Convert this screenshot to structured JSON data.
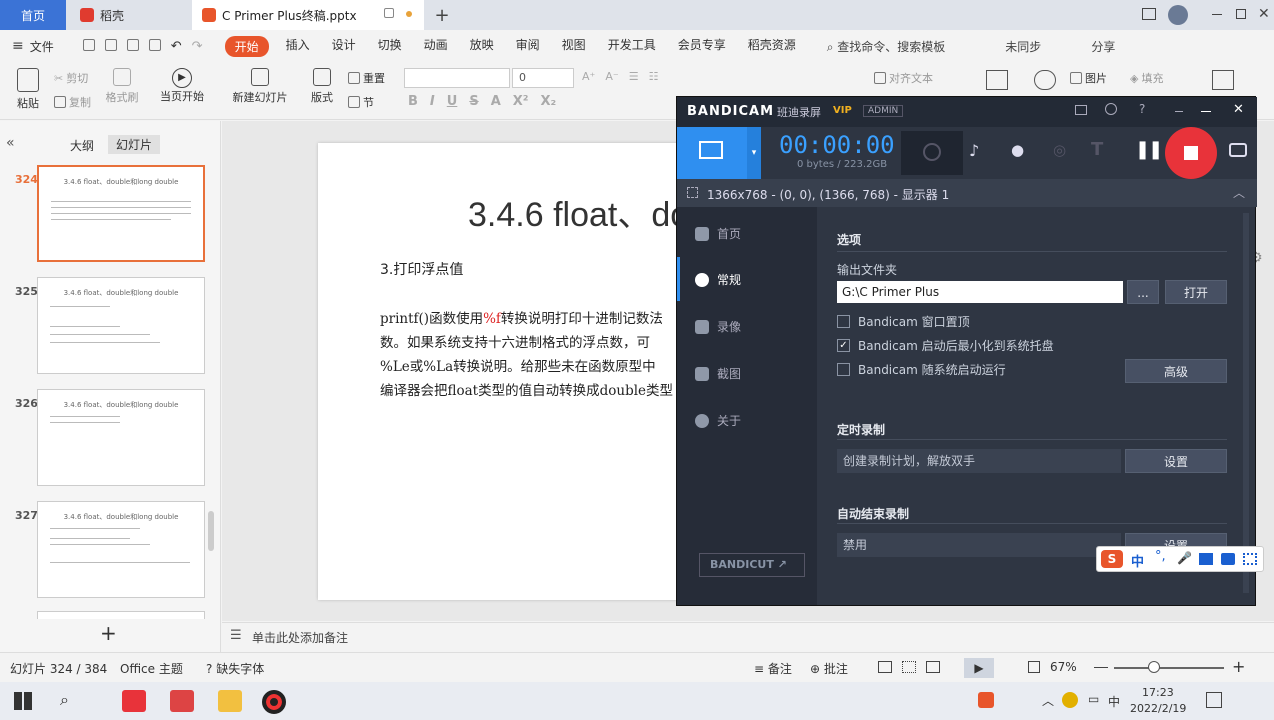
{
  "tabs": {
    "home": "首页",
    "daoke": "稻壳",
    "document": "C Primer  Plus终稿.pptx",
    "new_tab": "+"
  },
  "menu": {
    "file": "文件",
    "items": [
      "开始",
      "插入",
      "设计",
      "切换",
      "动画",
      "放映",
      "审阅",
      "视图",
      "开发工具",
      "会员专享",
      "稻壳资源"
    ],
    "search": "查找命令、搜索模板",
    "collab": "未同步",
    "share": "分享"
  },
  "ribbon": {
    "paste": "粘贴",
    "cut": "剪切",
    "copy": "复制",
    "format_painter": "格式刷",
    "from_current": "当页开始",
    "new_slide": "新建幻灯片",
    "layout": "版式",
    "section": "节",
    "reset": "重置",
    "font_size": "0",
    "align_text": "对齐文本",
    "picture": "图片",
    "fill": "填充"
  },
  "left_panel": {
    "tab_outline": "大纲",
    "tab_slides": "幻灯片",
    "slides": [
      {
        "num": "324",
        "title": "3.4.6 float、double和long double"
      },
      {
        "num": "325",
        "title": "3.4.6 float、double和long double"
      },
      {
        "num": "326",
        "title": "3.4.6 float、double和long double"
      },
      {
        "num": "327",
        "title": "3.4.6 float、double和long double"
      }
    ],
    "add": "+"
  },
  "slide": {
    "title": "3.4.6 float、do",
    "subtitle": "3.打印浮点值",
    "body_lines": [
      {
        "pre": "printf()函数使用",
        "red": "%f",
        "post": "转换说明打印十进制记数法"
      },
      {
        "pre": "数。如果系统支持十六进制格式的浮点数，可",
        "red": "",
        "post": ""
      },
      {
        "pre": "%Le或%La转换说明。给那些未在函数原型中",
        "red": "",
        "post": ""
      },
      {
        "pre": "编译器会把float类型的值自动转换成double类型",
        "red": "",
        "post": ""
      }
    ]
  },
  "notes": {
    "placeholder": "单击此处添加备注"
  },
  "status": {
    "slide_count": "幻灯片 324 / 384",
    "theme": "Office 主题",
    "missing_font": "缺失字体",
    "notes_btn": "备注",
    "comments_btn": "批注",
    "zoom": "67%"
  },
  "taskbar": {
    "time": "17:23",
    "date": "2022/2/19",
    "ime_lang": "中"
  },
  "bandicam": {
    "brand": "BANDICAM",
    "tag_class": "班迪录屏",
    "tag_vip": "VIP",
    "tag_admin": "ADMIN",
    "timer": "00:00:00",
    "size": "0 bytes / 223.2GB",
    "region": "1366x768 - (0, 0), (1366, 768) - 显示器 1",
    "nav": [
      "首页",
      "常规",
      "录像",
      "截图",
      "关于"
    ],
    "bandicut": "BANDICUT",
    "section_options": "选项",
    "output_label": "输出文件夹",
    "output_path": "G:\\C Primer Plus",
    "browse": "...",
    "open": "打开",
    "opt_top": "Bandicam 窗口置顶",
    "opt_tray": "Bandicam 启动后最小化到系统托盘",
    "opt_startup": "Bandicam 随系统启动运行",
    "advanced": "高级",
    "section_schedule": "定时录制",
    "schedule_field": "创建录制计划，解放双手",
    "schedule_btn": "设置",
    "section_autostop": "自动结束录制",
    "autostop_field": "禁用",
    "autostop_btn": "设置"
  },
  "ime": {
    "lang": "中"
  },
  "colors": {
    "accent": "#e8552b",
    "tab_blue": "#3b73d6",
    "bandicam_bg": "#2b3240",
    "record_red": "#e8333a",
    "timer_blue": "#3aa0ff"
  }
}
